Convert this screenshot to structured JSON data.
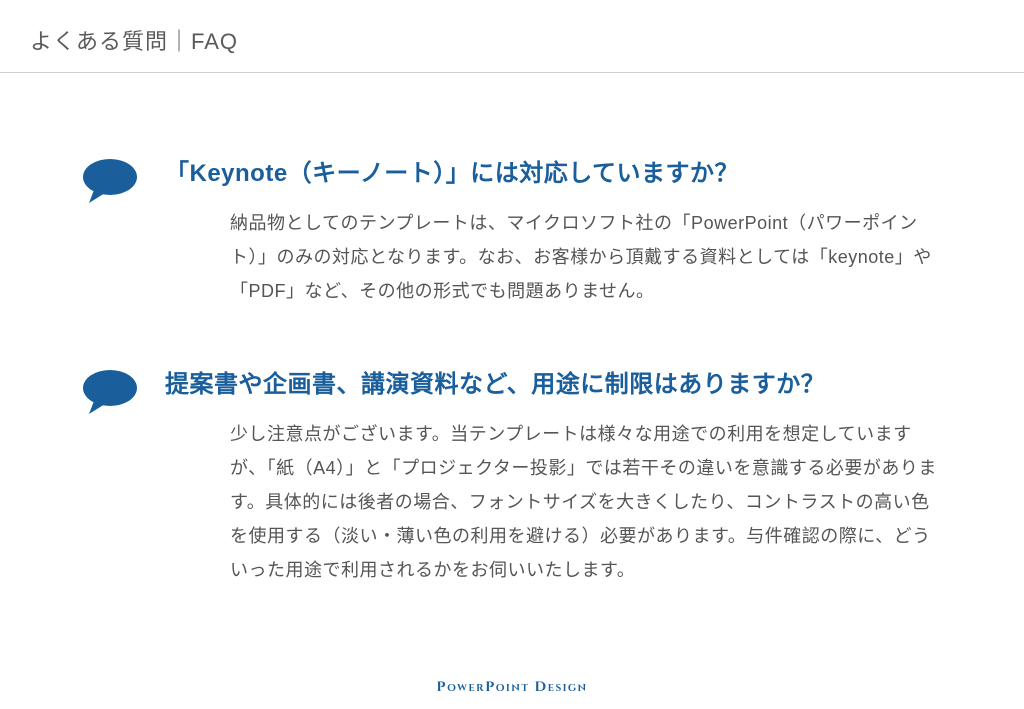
{
  "header": {
    "title": "よくある質問｜FAQ"
  },
  "faqs": [
    {
      "question": "「Keynote（キーノート）」には対応していますか？",
      "answer": "納品物としてのテンプレートは、マイクロソフト社の「PowerPoint（パワーポイント）」のみの対応となります。なお、お客様から頂戴する資料としては「keynote」や「PDF」など、その他の形式でも問題ありません。"
    },
    {
      "question": "提案書や企画書、講演資料など、用途に制限はありますか？",
      "answer": "少し注意点がございます。当テンプレートは様々な用途での利用を想定していますが、「紙（A4）」と「プロジェクター投影」では若干その違いを意識する必要があります。具体的には後者の場合、フォントサイズを大きくしたり、コントラストの高い色を使用する（淡い・薄い色の利用を避ける）必要があります。与件確認の際に、どういった用途で利用されるかをお伺いいたします。"
    }
  ],
  "footer": {
    "brand": "PowerPoint Design"
  }
}
